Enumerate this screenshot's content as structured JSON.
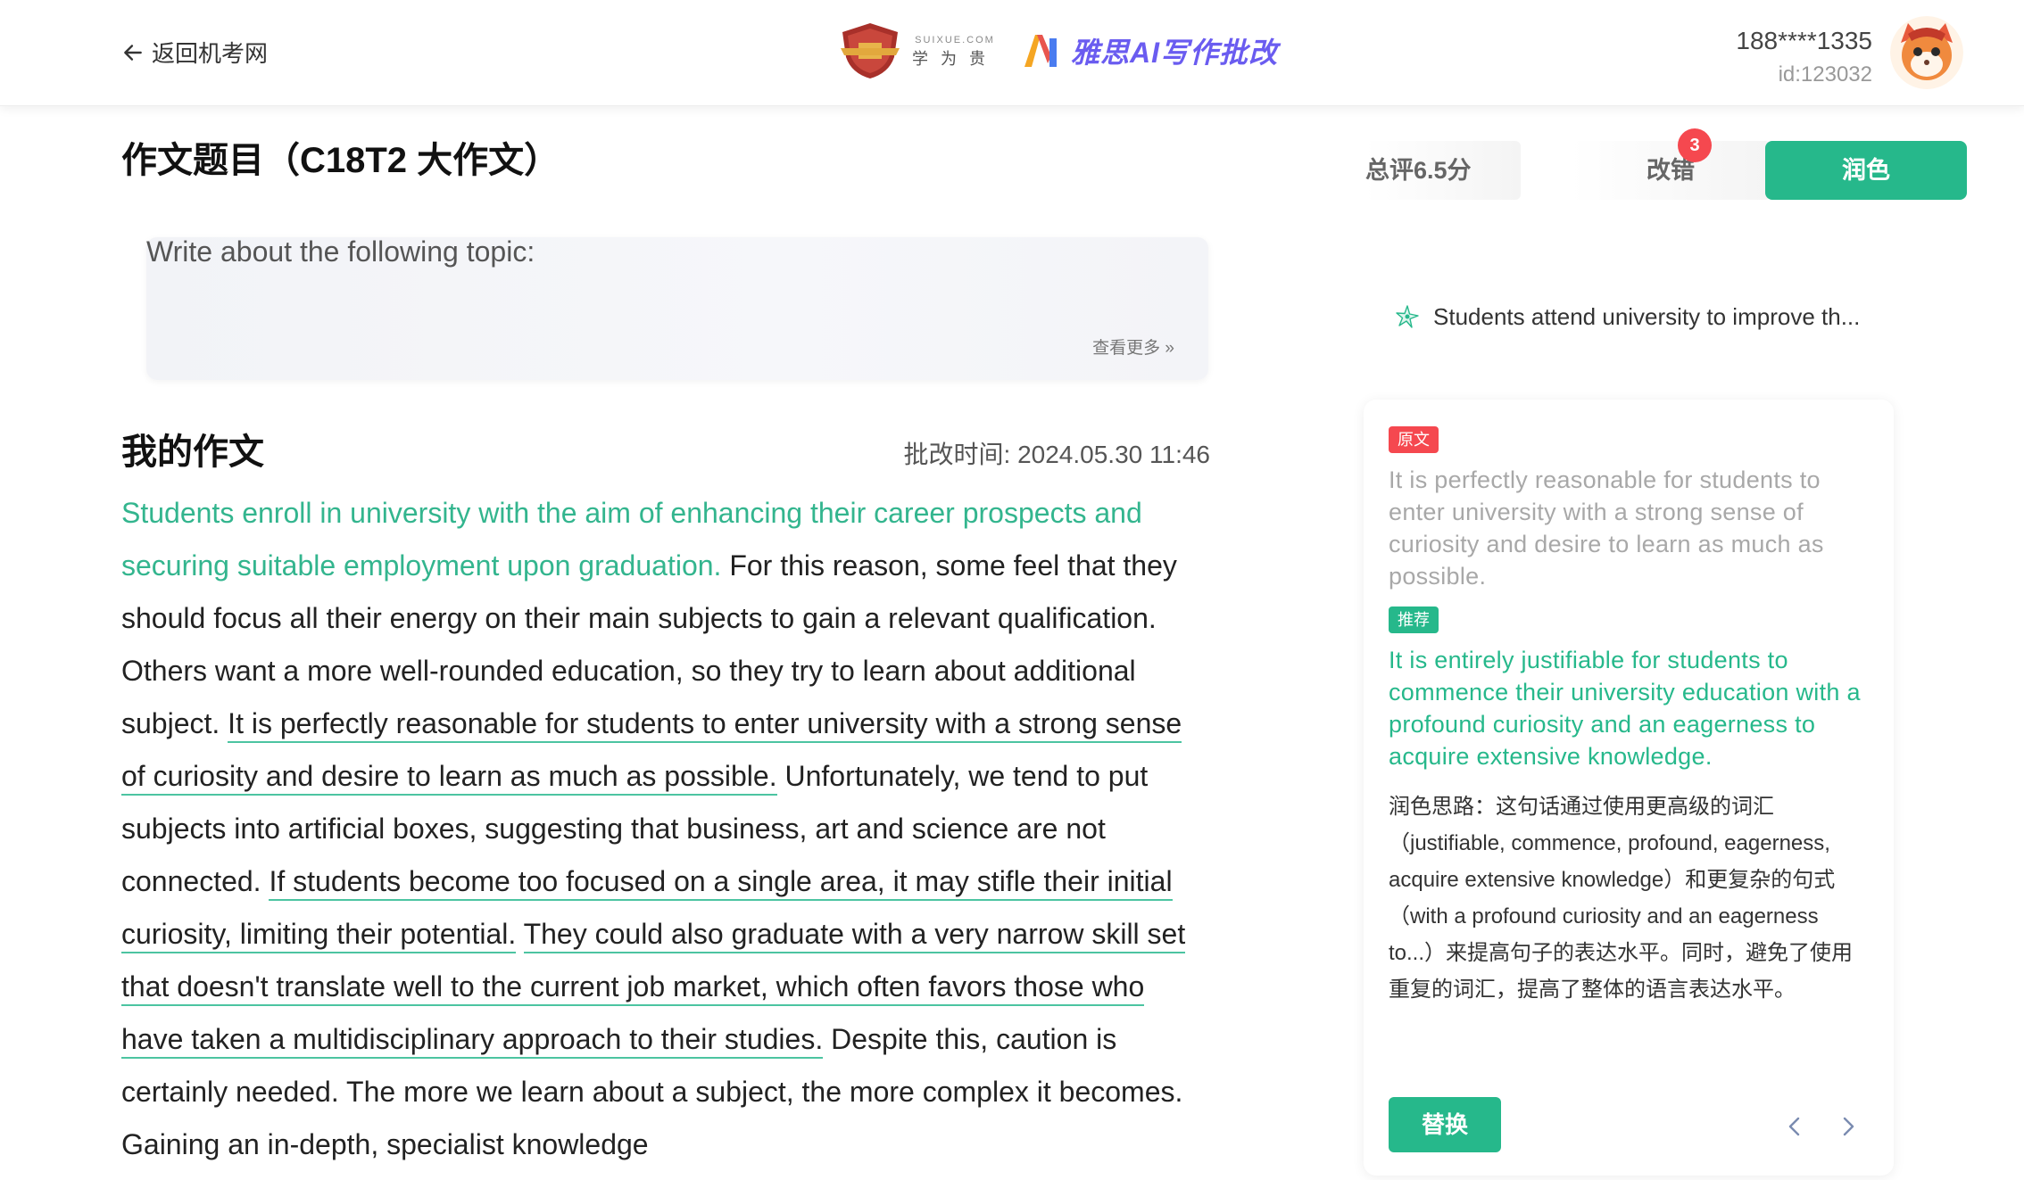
{
  "header": {
    "back_label": "返回机考网",
    "brand_site": "SUIXUE.COM",
    "brand_cn": "学为贵",
    "product_title": "雅思AI写作批改",
    "user_phone": "188****1335",
    "user_id": "id:123032"
  },
  "main": {
    "page_title": "作文题目（C18T2 大作文）",
    "topic_prompt": "Write about the following topic:",
    "topic_more": "查看更多 »",
    "essay_title": "我的作文",
    "review_time": "批改时间: 2024.05.30 11:46",
    "essay_segments": [
      "Students enroll in university with the aim of enhancing their career prospects and securing suitable employment upon graduation.",
      " For this reason, some feel that they should focus all their energy on their main subjects to gain a relevant qualification. Others want a more well-rounded education, so they try to learn about additional subject. ",
      "It is perfectly reasonable for students to enter university with a strong sense of curiosity and desire to learn as much as possible.",
      " Unfortunately, we tend to put subjects into artificial boxes, suggesting that business, art and science are not connected. ",
      "If students become too focused on a single area, it may stifle their initial curiosity, limiting their potential.",
      " ",
      "They could also graduate with a very narrow skill set that doesn't translate well to the current job market, which often favors those who have taken a multidisciplinary approach to their studies.",
      " Despite this, caution is certainly needed. The more we learn about a subject, the more complex it becomes. Gaining an in-depth, specialist knowledge"
    ]
  },
  "panel": {
    "tab_score": "总评6.5分",
    "tab_errors": "改错",
    "tab_errors_count": "3",
    "tab_polish": "润色",
    "sentence": "Students attend university to improve th...",
    "original_tag": "原文",
    "original_text": "It is perfectly reasonable for students to enter university with a strong sense of curiosity and desire to learn as much as possible.",
    "recommend_tag": "推荐",
    "recommend_text": "It is entirely justifiable for students to commence their university education with a profound curiosity and an eagerness to acquire extensive knowledge.",
    "tips": "润色思路：这句话通过使用更高级的词汇（justifiable, commence, profound, eagerness, acquire extensive knowledge）和更复杂的句式（with a profound curiosity and an eagerness to...）来提高句子的表达水平。同时，避免了使用重复的词汇，提高了整体的语言表达水平。",
    "replace_label": "替换"
  },
  "colors": {
    "accent": "#26b88b",
    "highlight_text": "#33b58e",
    "badge_red": "#f5484f",
    "brand_purple": "#6a5cf0"
  },
  "icons": [
    "arrow-left-icon",
    "shield-logo-icon",
    "ai-logo-icon",
    "avatar",
    "sparkle-icon",
    "chevron-left-icon",
    "chevron-right-icon"
  ]
}
